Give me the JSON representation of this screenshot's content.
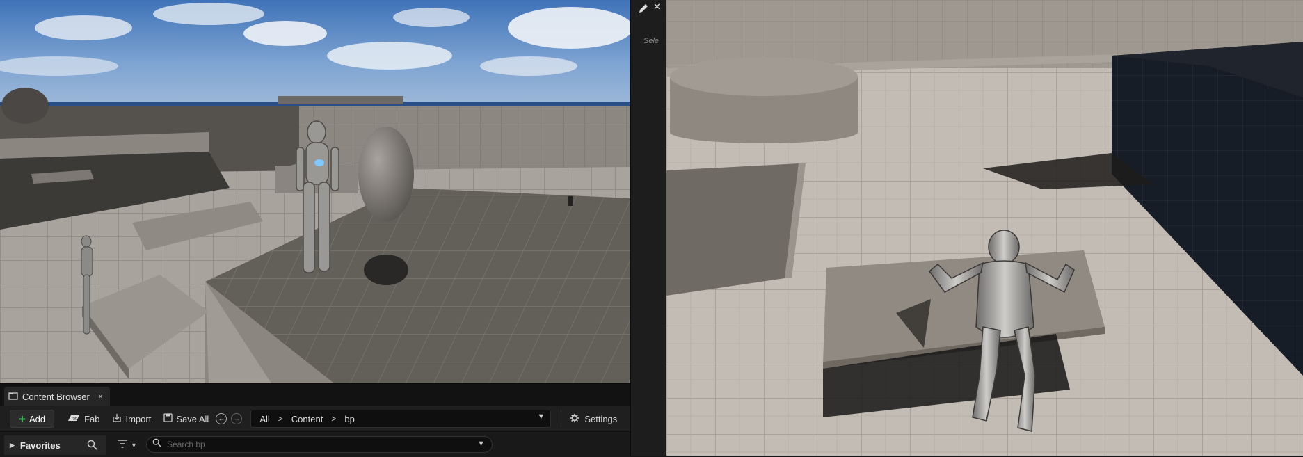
{
  "mid_panel": {
    "selection_hint": "Sele"
  },
  "content_browser": {
    "tab_label": "Content Browser",
    "tab_close": "×",
    "toolbar": {
      "add_label": "Add",
      "fab_label": "Fab",
      "import_label": "Import",
      "save_all_label": "Save All",
      "settings_label": "Settings"
    },
    "breadcrumb": [
      "All",
      "Content",
      "bp"
    ],
    "favorites_label": "Favorites",
    "search": {
      "placeholder": "Search bp",
      "value": ""
    }
  },
  "icons": [
    "pencil-icon",
    "close-icon",
    "content-browser-icon",
    "plus-icon",
    "fab-icon",
    "import-icon",
    "save-icon",
    "back-icon",
    "forward-icon",
    "gear-icon",
    "search-icon",
    "filter-icon",
    "chevron-down-icon"
  ]
}
